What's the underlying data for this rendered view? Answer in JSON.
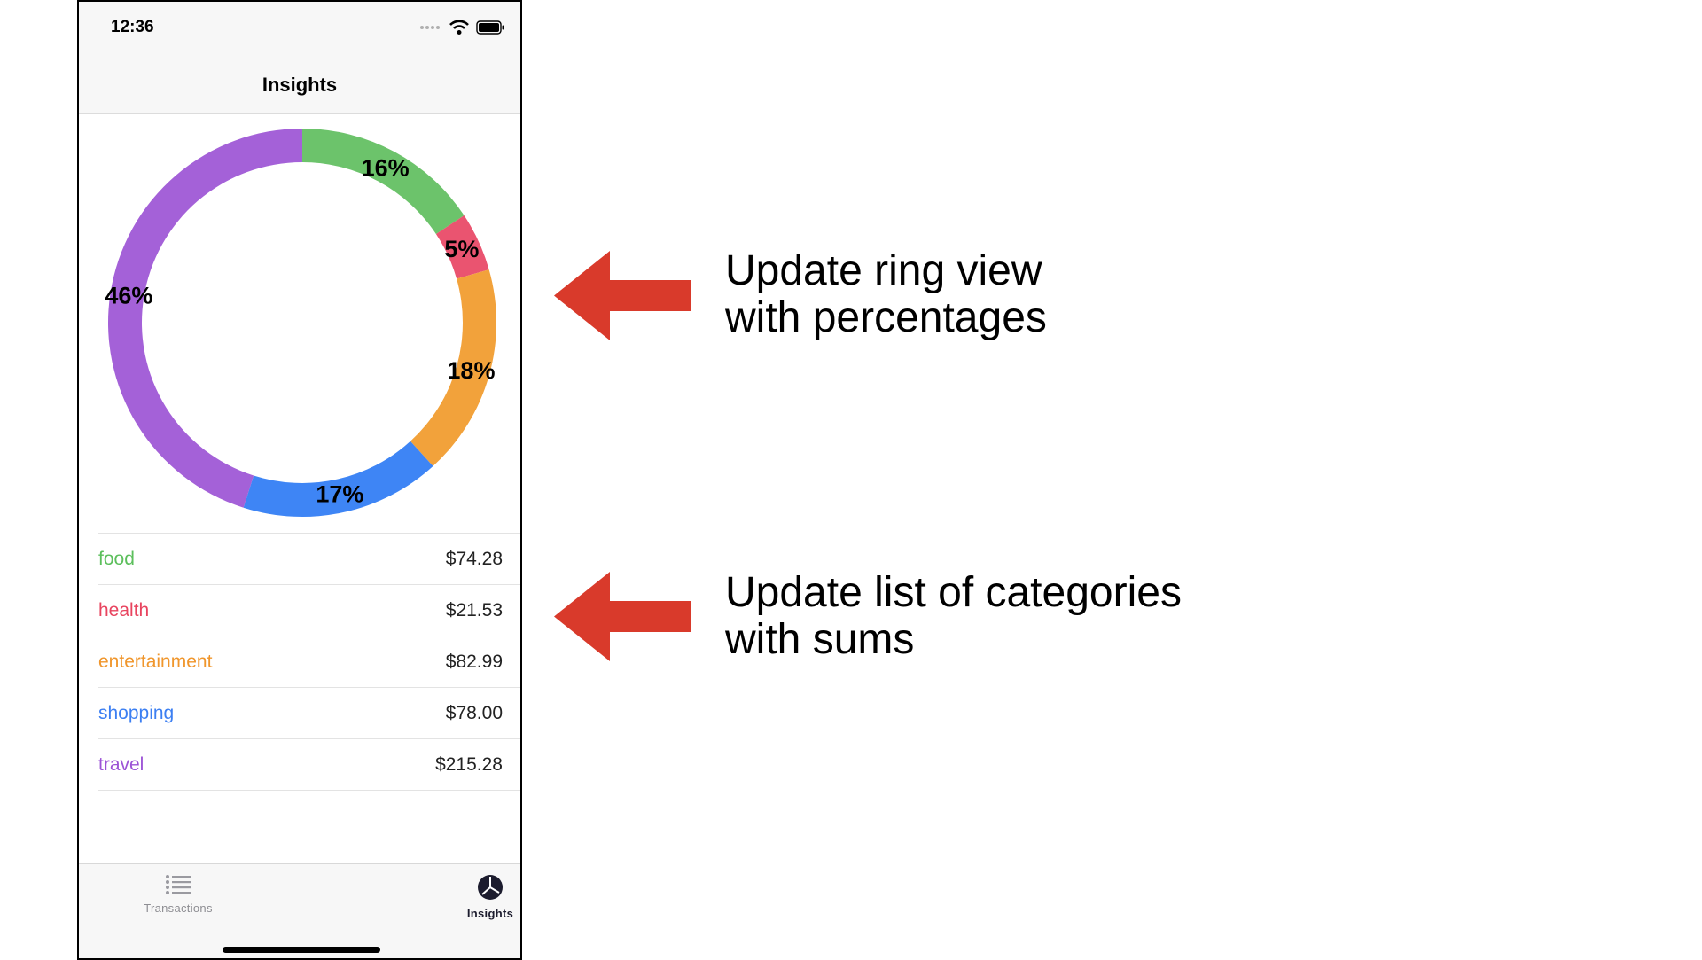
{
  "status_bar": {
    "time": "12:36"
  },
  "nav": {
    "title": "Insights"
  },
  "chart_data": {
    "type": "pie",
    "style": "donut",
    "labels": [
      "food",
      "health",
      "entertainment",
      "shopping",
      "travel"
    ],
    "values": [
      16,
      5,
      18,
      17,
      46
    ],
    "value_labels": [
      "16%",
      "5%",
      "18%",
      "17%",
      "46%"
    ],
    "colors": [
      "#6cc36b",
      "#ea5470",
      "#f2a23b",
      "#3e85f5",
      "#a461d8"
    ]
  },
  "categories": [
    {
      "name": "food",
      "sum": "$74.28",
      "color": "#5cbf5c"
    },
    {
      "name": "health",
      "sum": "$21.53",
      "color": "#e8445f"
    },
    {
      "name": "entertainment",
      "sum": "$82.99",
      "color": "#f0962c"
    },
    {
      "name": "shopping",
      "sum": "$78.00",
      "color": "#3c7ff2"
    },
    {
      "name": "travel",
      "sum": "$215.28",
      "color": "#9c53d6"
    }
  ],
  "tabs": [
    {
      "label": "Transactions",
      "icon": "list-icon",
      "active": false
    },
    {
      "label": "Insights",
      "icon": "pie-chart-icon",
      "active": true
    }
  ],
  "annotations": [
    {
      "lines": [
        "Update ring view",
        "with percentages"
      ]
    },
    {
      "lines": [
        "Update list of categories",
        "with sums"
      ]
    }
  ],
  "colors": {
    "arrow": "#d93a2b",
    "tab_active": "#1c1c2e",
    "tab_inactive": "#8e8e93"
  }
}
